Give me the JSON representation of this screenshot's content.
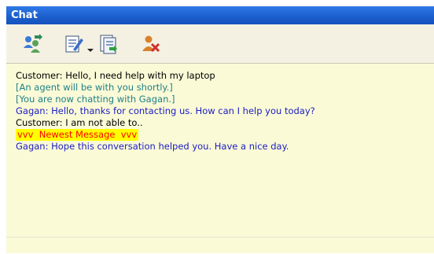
{
  "window": {
    "title": "Chat"
  },
  "toolbar": {
    "buttons": [
      {
        "icon": "transfer-users-icon"
      },
      {
        "icon": "edit-notes-icon"
      },
      {
        "icon": "document-export-icon"
      },
      {
        "icon": "end-chat-icon"
      }
    ]
  },
  "chat": {
    "lines": [
      {
        "speaker": "customer",
        "text": "Customer: Hello, I need help with my laptop"
      },
      {
        "speaker": "system",
        "text": "[An agent will be with you shortly.]"
      },
      {
        "speaker": "system",
        "text": "[You are now chatting with Gagan.]"
      },
      {
        "speaker": "agent",
        "text": "Gagan: Hello, thanks for contacting us. How can I help you today?"
      },
      {
        "speaker": "customer",
        "text": "Customer: I am not able to.."
      },
      {
        "speaker": "marker",
        "text": "vvv  Newest Message  vvv"
      },
      {
        "speaker": "agent",
        "text": "Gagan: Hope this conversation helped you. Have a nice day."
      }
    ]
  },
  "colors": {
    "titlebar": "#1c5fce",
    "background": "#fafad7",
    "customer_text": "#000000",
    "system_text": "#1e7f86",
    "agent_text": "#1c1cc4",
    "marker_text": "#ff0000",
    "marker_highlight": "#ffff00"
  }
}
